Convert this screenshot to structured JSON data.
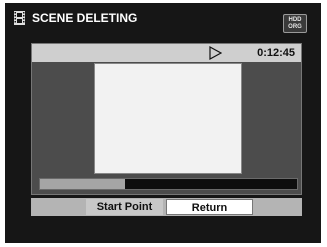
{
  "window": {
    "title": "SCENE DELETING",
    "badge_lines": [
      "HDD",
      "ORG"
    ]
  },
  "player": {
    "timecode": "0:12:45",
    "play_state_icon": "play-outline-icon",
    "progress_fraction": 0.33
  },
  "buttons": {
    "start_point_label": "Start Point",
    "return_label": "Return"
  },
  "colors": {
    "screen_background": "#161616",
    "preview_frame": "#f2f2f2",
    "progress_fill": "#a5a5a5"
  }
}
